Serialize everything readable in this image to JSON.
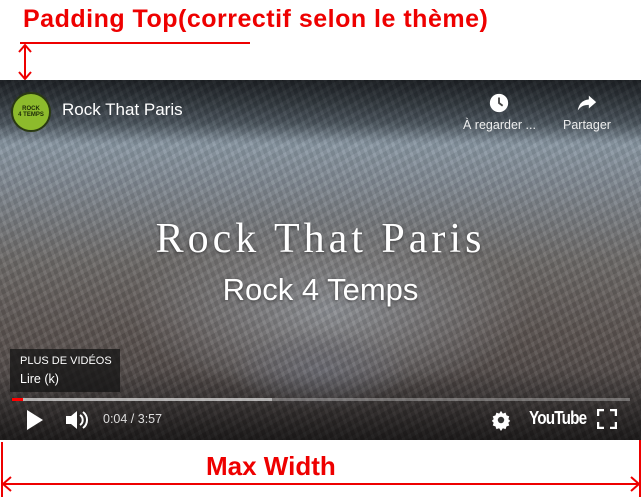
{
  "annotations": {
    "top": "Padding Top(correctif selon le thème)",
    "bottom": "Max Width"
  },
  "player": {
    "channel_logo_text": [
      "ROCK",
      "4 TEMPS"
    ],
    "title": "Rock That Paris",
    "watch_later_label": "À regarder ...",
    "share_label": "Partager",
    "overlay_title": "Rock That Paris",
    "overlay_subtitle": "Rock 4 Temps",
    "more_videos_label": "PLUS DE VIDÉOS",
    "more_videos_tooltip": "Lire (k)",
    "current_time": "0:04",
    "duration": "3:57",
    "time_display": "0:04 / 3:57",
    "progress_fraction": 0.017,
    "buffered_fraction": 0.42,
    "brand": "YouTube",
    "accent_color": "#ff0000"
  }
}
